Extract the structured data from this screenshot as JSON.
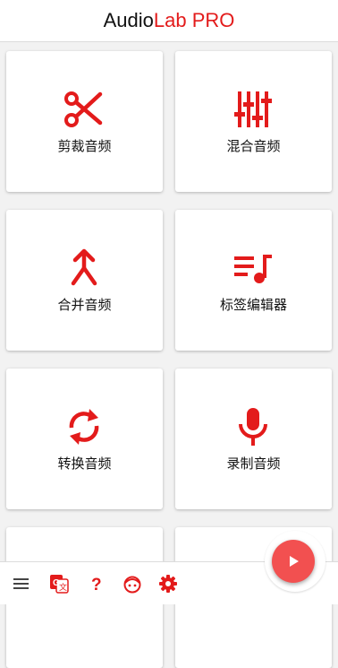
{
  "app": {
    "title_part1": "Audio",
    "title_part2": "Lab PRO",
    "accent_color": "#e31b1b"
  },
  "tools": [
    {
      "label": "剪裁音频",
      "icon": "scissors-icon"
    },
    {
      "label": "混合音频",
      "icon": "equalizer-sliders-icon"
    },
    {
      "label": "合并音频",
      "icon": "merge-arrow-icon"
    },
    {
      "label": "标签编辑器",
      "icon": "playlist-music-icon"
    },
    {
      "label": "转换音频",
      "icon": "refresh-icon"
    },
    {
      "label": "录制音频",
      "icon": "microphone-icon"
    }
  ],
  "bottom_nav": {
    "items": [
      "menu-icon",
      "translate-icon",
      "help-icon",
      "face-icon",
      "settings-icon"
    ],
    "fab_icon": "play-icon"
  }
}
